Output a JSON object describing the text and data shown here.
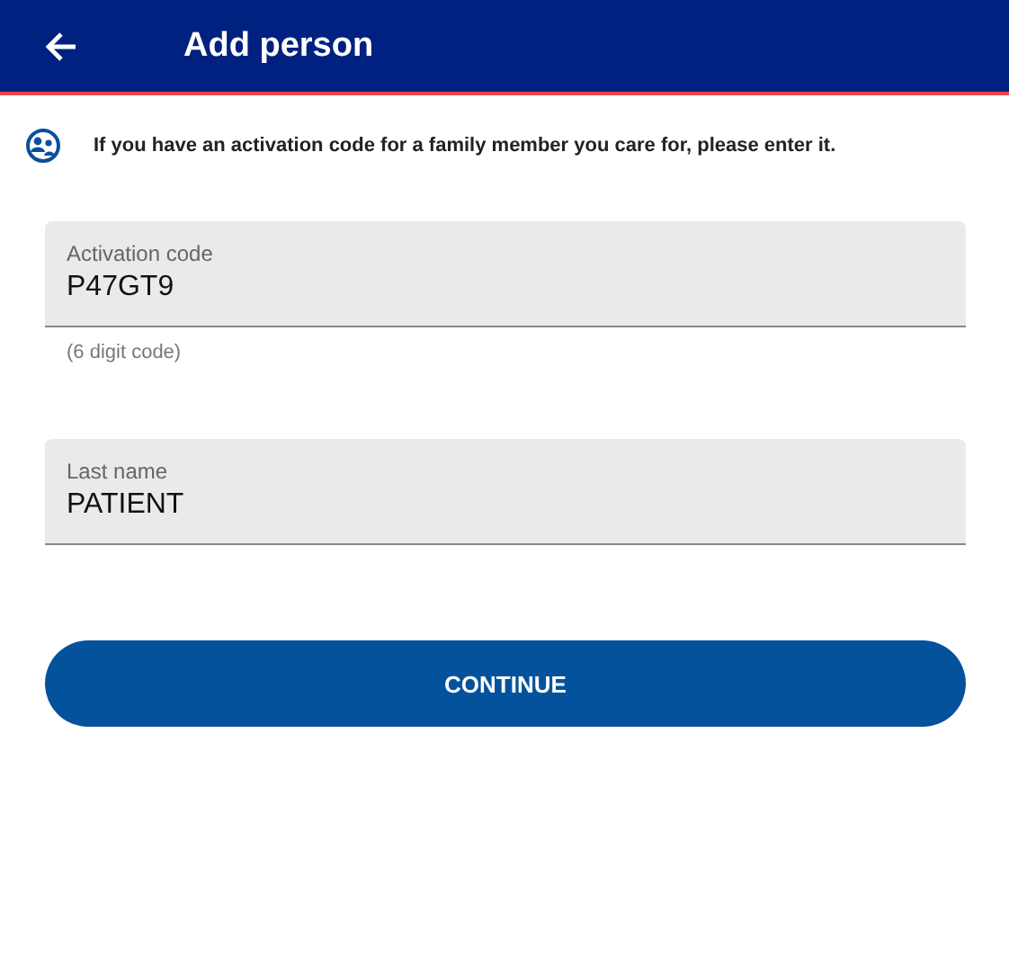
{
  "header": {
    "title": "Add person"
  },
  "info": {
    "text": "If you have an activation code for a family member you care for, please enter it."
  },
  "fields": [
    {
      "label": "Activation code",
      "value": "P47GT9",
      "hint": "(6 digit code)"
    },
    {
      "label": "Last name",
      "value": "PATIENT"
    }
  ],
  "button": {
    "label": "CONTINUE"
  }
}
